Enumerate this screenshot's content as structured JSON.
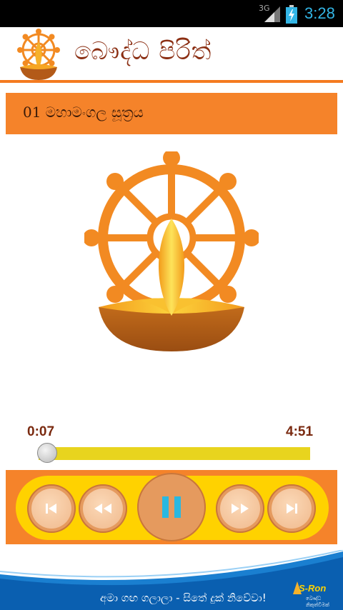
{
  "status_bar": {
    "network": "3G",
    "time": "3:28"
  },
  "header": {
    "title": "බෞද්ධ පිරිත්"
  },
  "player": {
    "track_title": "01 මහාමංගල සූත්‍රය",
    "current_time": "0:07",
    "total_time": "4:51",
    "progress": 0.02
  },
  "controls": [
    "skip-previous",
    "rewind",
    "pause",
    "fast-forward",
    "skip-next"
  ],
  "banner": {
    "slogan": "අමා ගඟ ගලාලා - සිතේ දුක් නිවේවා!",
    "brand": "S-Ron",
    "brand_sub": "බෞද්ධ නිකුත්වීමක්"
  },
  "colors": {
    "accent": "#f5832a",
    "accent_yellow": "#ffd200",
    "title_text": "#8b2e12",
    "status_time": "#33b5e5",
    "banner_blue": "#0a5fb0"
  }
}
